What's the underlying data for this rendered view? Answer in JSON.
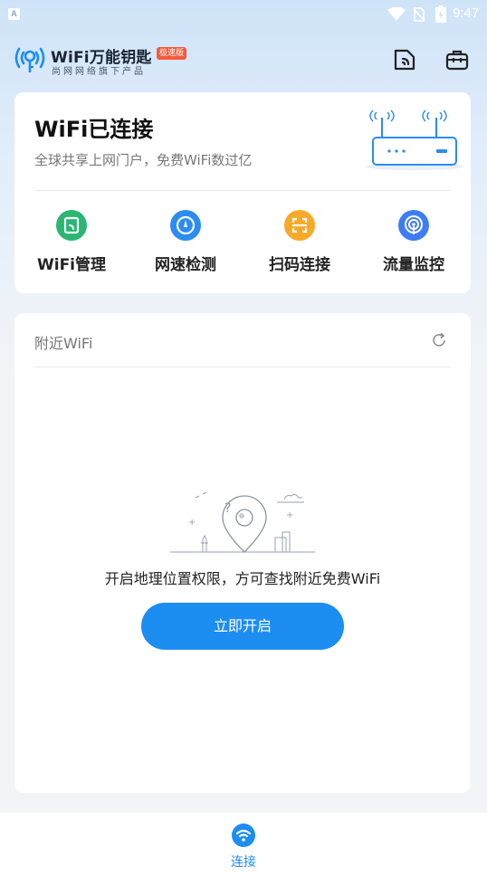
{
  "status_bar": {
    "app_icon_letter": "A",
    "time": "9:47",
    "icons": [
      "wifi-icon",
      "no-sim-icon",
      "battery-charging-icon"
    ]
  },
  "header": {
    "brand_name": "WiFi万能钥匙",
    "brand_badge": "极速版",
    "brand_sub": "尚网网络旗下产品",
    "right_icons": [
      "document-wifi-icon",
      "toolbox-icon"
    ]
  },
  "status_card": {
    "title": "WiFi已连接",
    "subtitle": "全球共享上网门户，免费WiFi数过亿",
    "tools": [
      {
        "label": "WiFi管理",
        "icon": "wifi-manage-icon",
        "color": "#2bb673"
      },
      {
        "label": "网速检测",
        "icon": "speed-test-icon",
        "color": "#2b8cf2"
      },
      {
        "label": "扫码连接",
        "icon": "scan-connect-icon",
        "color": "#f7a928"
      },
      {
        "label": "流量监控",
        "icon": "traffic-monitor-icon",
        "color": "#3d7cf5"
      }
    ]
  },
  "nearby": {
    "title": "附近WiFi",
    "permission_text": "开启地理位置权限，方可查找附近免费WiFi",
    "open_button": "立即开启"
  },
  "bottom_nav": {
    "items": [
      {
        "label": "连接",
        "icon": "wifi-connect-icon",
        "active": true
      }
    ]
  },
  "colors": {
    "accent": "#1c8df1",
    "badge": "#f35b3d"
  }
}
